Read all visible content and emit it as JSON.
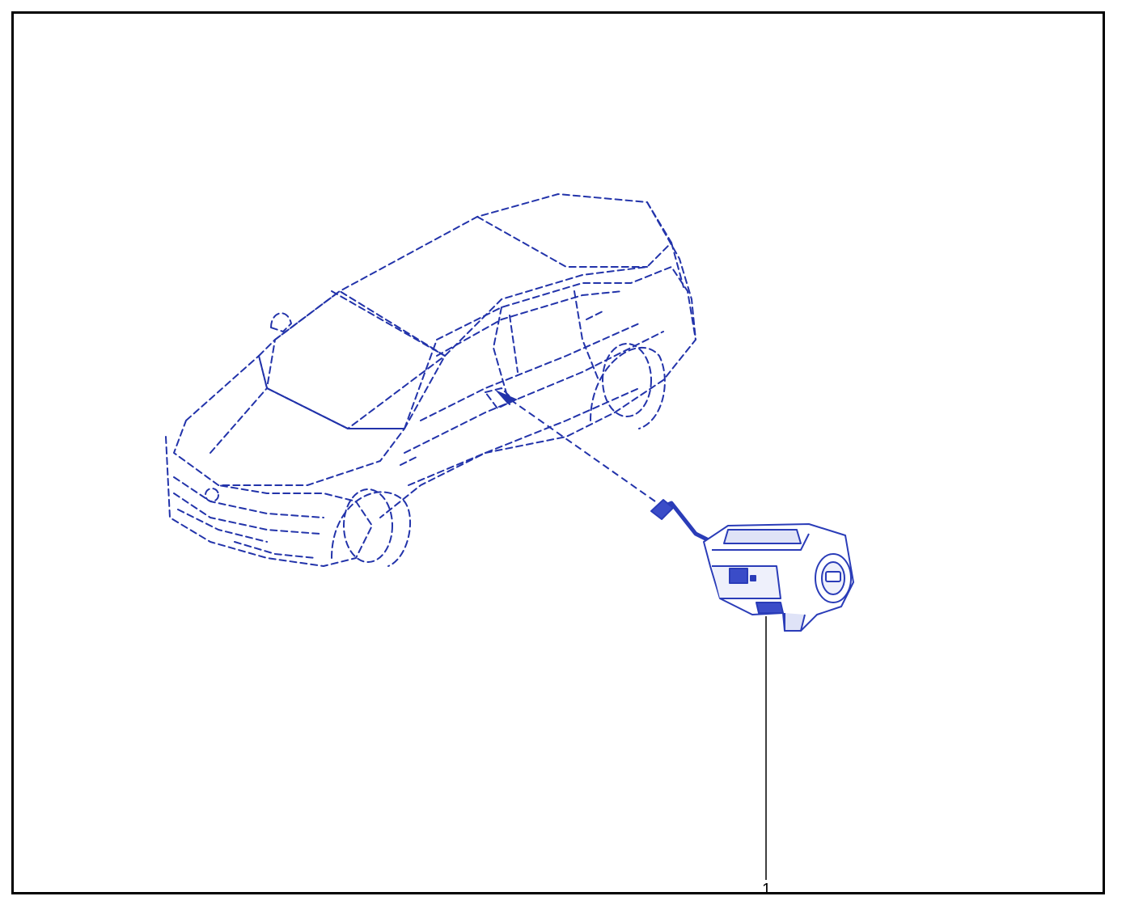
{
  "diagram": {
    "line_color": "#2233aa",
    "part_color": "#2a3cb8",
    "frame_color": "#000000",
    "icons": {
      "vehicle": "vehicle-outline-dashed",
      "part": "ignition-switch-module"
    },
    "callouts": [
      {
        "label": "1"
      }
    ]
  }
}
